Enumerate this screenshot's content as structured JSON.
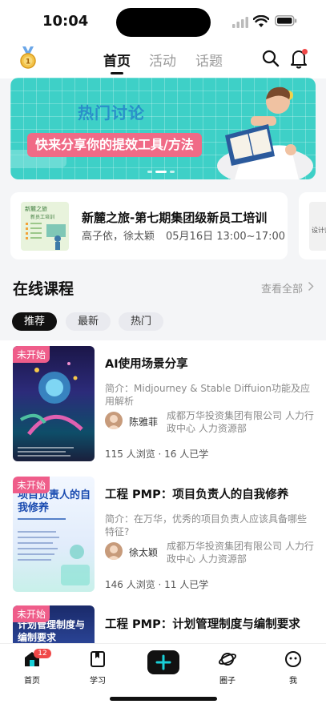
{
  "status": {
    "time": "10:04"
  },
  "header": {
    "tabs": [
      "首页",
      "活动",
      "话题"
    ],
    "active_tab": 0
  },
  "banner": {
    "title": "热门讨论",
    "subtitle": "快来分享你的提效工具/方法"
  },
  "event": {
    "title": "新麓之旅-第七期集团级新员工培训",
    "people": "高子依，徐太颖",
    "time": "05月16日 13:00~17:00",
    "thumb_lines": [
      "新麓之旅",
      "新员工培训"
    ],
    "next_thumb_text": "设计师"
  },
  "online": {
    "title": "在线课程",
    "see_all": "查看全部"
  },
  "filters": [
    "推荐",
    "最新",
    "热门"
  ],
  "courses": [
    {
      "tag": "未开始",
      "title": "AI使用场景分享",
      "desc": "简介：Midjourney & Stable Diffuion功能及应用解析",
      "teacher": "陈雅菲",
      "org": "成都万华投资集团有限公司 人力行政中心 人力资源部",
      "stats": "115 人浏览 · 16 人已学"
    },
    {
      "tag": "未开始",
      "title": "工程 PMP：项目负责人的自我修养",
      "desc": "简介：在万华，优秀的项目负责人应该具备哪些特征?",
      "teacher": "徐太颖",
      "org": "成都万华投资集团有限公司 人力行政中心 人力资源部",
      "stats": "146 人浏览 · 11 人已学",
      "thumb_title": "项目负责人的自我修养"
    },
    {
      "tag": "未开始",
      "title": "工程 PMP：计划管理制度与编制要求",
      "thumb_title": "计划管理制度与编制要求"
    }
  ],
  "tabbar": {
    "items": [
      "首页",
      "学习",
      "",
      "圈子",
      "我"
    ],
    "badge": "12"
  },
  "colors": {
    "tag_pink": "#ef5d8a",
    "banner_teal": "#3ed0c7",
    "accent_cyan": "#19d0d8"
  }
}
